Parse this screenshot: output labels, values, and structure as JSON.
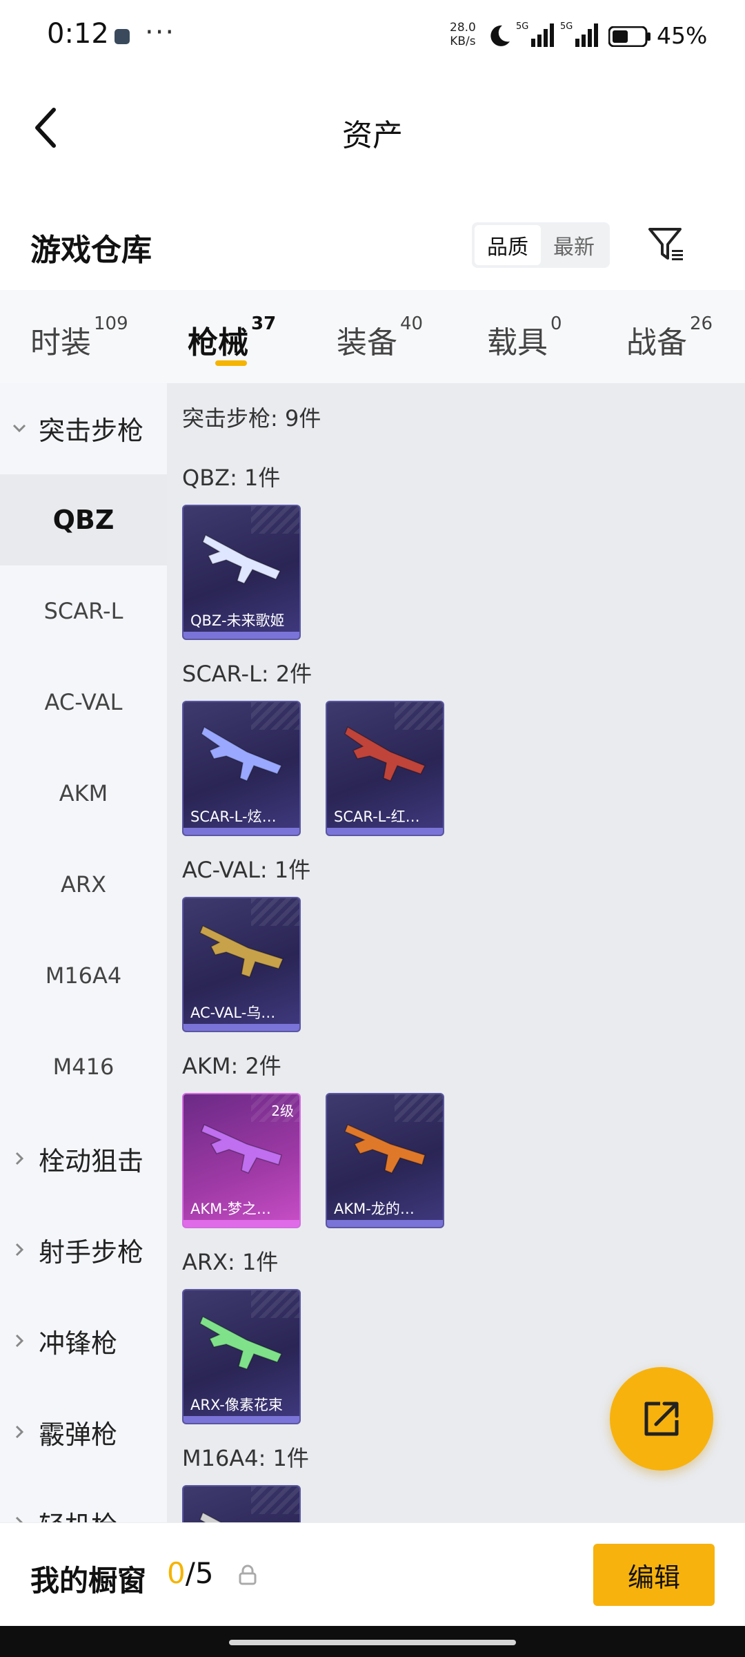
{
  "status_bar": {
    "time": "0:12",
    "net_speed_value": "28.0",
    "net_speed_unit": "KB/s",
    "sig1_label": "5G",
    "sig2_label": "5G",
    "battery_pct": "45%"
  },
  "nav": {
    "title": "资产"
  },
  "header": {
    "section_title": "游戏仓库",
    "sort_options": [
      "品质",
      "最新"
    ],
    "sort_selected": "品质"
  },
  "tabs": [
    {
      "label": "时装",
      "count": "109"
    },
    {
      "label": "枪械",
      "count": "37",
      "active": true
    },
    {
      "label": "装备",
      "count": "40"
    },
    {
      "label": "载具",
      "count": "0"
    },
    {
      "label": "战备",
      "count": "26"
    }
  ],
  "sidebar": {
    "expanded_group": "突击步枪",
    "items": [
      "QBZ",
      "SCAR-L",
      "AC-VAL",
      "AKM",
      "ARX",
      "M16A4",
      "M416"
    ],
    "selected_item": "QBZ",
    "collapsed_groups": [
      "栓动狙击",
      "射手步枪",
      "冲锋枪",
      "霰弹枪",
      "轻机枪"
    ]
  },
  "content": {
    "total_label": "突击步枪: 9件",
    "groups": [
      {
        "label": "QBZ: 1件",
        "cards": [
          {
            "name": "QBZ-未来歌姬",
            "rarity": "purple",
            "gun_color": "#dfe6ff"
          }
        ]
      },
      {
        "label": "SCAR-L: 2件",
        "cards": [
          {
            "name": "SCAR-L-炫…",
            "rarity": "purple",
            "gun_color": "#9aa8ff"
          },
          {
            "name": "SCAR-L-红…",
            "rarity": "purple",
            "gun_color": "#c0443a"
          }
        ]
      },
      {
        "label": "AC-VAL: 1件",
        "cards": [
          {
            "name": "AC-VAL-乌…",
            "rarity": "purple",
            "gun_color": "#c8a24a"
          }
        ]
      },
      {
        "label": "AKM: 2件",
        "cards": [
          {
            "name": "AKM-梦之…",
            "rarity": "pink",
            "badge": "2级",
            "gun_color": "#c06ff0"
          },
          {
            "name": "AKM-龙的…",
            "rarity": "purple",
            "gun_color": "#e0782a"
          }
        ]
      },
      {
        "label": "ARX: 1件",
        "cards": [
          {
            "name": "ARX-像素花束",
            "rarity": "purple",
            "gun_color": "#7fe28a"
          }
        ]
      },
      {
        "label": "M16A4: 1件",
        "cards": [
          {
            "name": "",
            "rarity": "purple",
            "gun_color": "#d0d0d0"
          }
        ]
      }
    ]
  },
  "bottom_bar": {
    "showcase_label": "我的橱窗",
    "showcase_current": "0",
    "showcase_total": "/5",
    "edit_label": "编辑"
  },
  "colors": {
    "accent": "#f7b20d",
    "card_purple": "#2a2554",
    "card_pink": "#a03aa6"
  },
  "icons": {
    "back": "chevron-left-icon",
    "filter": "filter-icon",
    "share": "share-external-icon",
    "lock": "lock-icon",
    "group_expanded": "chevron-down-icon",
    "group_collapsed": "chevron-right-icon"
  }
}
